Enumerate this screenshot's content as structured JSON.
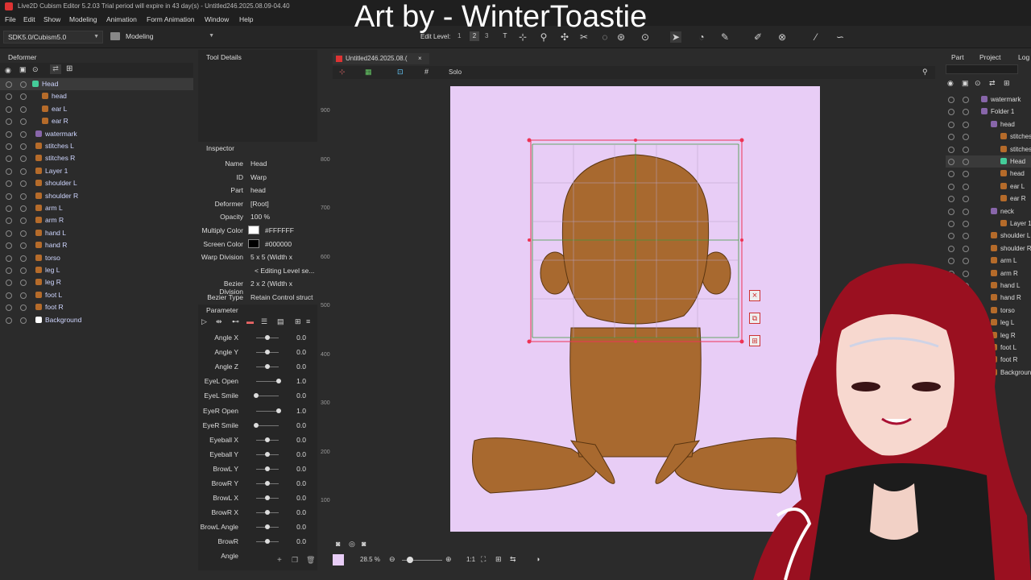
{
  "titlebar": {
    "text": "Live2D Cubism Editor 5.2.03   Trial period will expire in 43 day(s)  - Untitled246.2025.08.09-04.40"
  },
  "overlay": {
    "title": "Art by - WinterToastie"
  },
  "menu": [
    "File",
    "Edit",
    "Show",
    "Modeling",
    "Animation",
    "Form Animation",
    "Window",
    "Help"
  ],
  "toolbar": {
    "sdk": "SDK5.0/Cubism5.0",
    "mode": "Modeling",
    "edit_level_label": "Edit Level:",
    "edit_levels": [
      "1",
      "2",
      "3"
    ]
  },
  "deformer_panel": {
    "title": "Deformer",
    "items": [
      {
        "label": "Head",
        "kind": "warp"
      },
      {
        "label": "head",
        "kind": "art"
      },
      {
        "label": "ear L",
        "kind": "art"
      },
      {
        "label": "ear R",
        "kind": "art"
      },
      {
        "label": "watermark",
        "kind": "folder"
      },
      {
        "label": "stitches L",
        "kind": "art"
      },
      {
        "label": "stitches R",
        "kind": "art"
      },
      {
        "label": "Layer 1",
        "kind": "art"
      },
      {
        "label": "shoulder L",
        "kind": "art"
      },
      {
        "label": "shoulder R",
        "kind": "art"
      },
      {
        "label": "arm L",
        "kind": "art"
      },
      {
        "label": "arm R",
        "kind": "art"
      },
      {
        "label": "hand L",
        "kind": "art"
      },
      {
        "label": "hand R",
        "kind": "art"
      },
      {
        "label": "torso",
        "kind": "art"
      },
      {
        "label": "leg L",
        "kind": "art"
      },
      {
        "label": "leg R",
        "kind": "art"
      },
      {
        "label": "foot L",
        "kind": "art"
      },
      {
        "label": "foot R",
        "kind": "art"
      },
      {
        "label": "Background",
        "kind": "bg"
      }
    ]
  },
  "tool_details": {
    "title": "Tool Details"
  },
  "inspector": {
    "title": "Inspector",
    "rows": [
      {
        "label": "Name",
        "value": "Head"
      },
      {
        "label": "ID",
        "value": "Warp"
      },
      {
        "label": "Part",
        "value": "head"
      },
      {
        "label": "Deformer",
        "value": "[Root]"
      },
      {
        "label": "Opacity",
        "value": "100 %"
      },
      {
        "label": "Multiply Color",
        "value": "#FFFFFF"
      },
      {
        "label": "Screen Color",
        "value": "#000000"
      },
      {
        "label": "Warp Division",
        "value": "5  x     5 (Width x"
      },
      {
        "label": "",
        "value": "< Editing Level se..."
      },
      {
        "label": "Bezier Division",
        "value": "2  x     2 (Width x"
      },
      {
        "label": "Bezier Type",
        "value": "Retain Control struct"
      }
    ]
  },
  "parameter_panel": {
    "title": "Parameter",
    "params": [
      {
        "name": "Angle X",
        "value": "0.0",
        "level": 0.5
      },
      {
        "name": "Angle Y",
        "value": "0.0",
        "level": 0.5
      },
      {
        "name": "Angle Z",
        "value": "0.0",
        "level": 0.5
      },
      {
        "name": "EyeL Open",
        "value": "1.0",
        "level": 1.0
      },
      {
        "name": "EyeL Smile",
        "value": "0.0",
        "level": 0.0
      },
      {
        "name": "EyeR Open",
        "value": "1.0",
        "level": 1.0
      },
      {
        "name": "EyeR Smile",
        "value": "0.0",
        "level": 0.0
      },
      {
        "name": "Eyeball X",
        "value": "0.0",
        "level": 0.5
      },
      {
        "name": "Eyeball Y",
        "value": "0.0",
        "level": 0.5
      },
      {
        "name": "BrowL Y",
        "value": "0.0",
        "level": 0.5
      },
      {
        "name": "BrowR Y",
        "value": "0.0",
        "level": 0.5
      },
      {
        "name": "BrowL X",
        "value": "0.0",
        "level": 0.5
      },
      {
        "name": "BrowR X",
        "value": "0.0",
        "level": 0.5
      },
      {
        "name": "BrowL Angle",
        "value": "0.0",
        "level": 0.5
      },
      {
        "name": "BrowR Angle",
        "value": "0.0",
        "level": 0.5
      }
    ]
  },
  "canvas": {
    "tab": "Untitled246.2025.08.(",
    "solo": "Solo",
    "zoom": "28.5 %",
    "ruler": [
      "900",
      "800",
      "700",
      "600",
      "500",
      "400",
      "300",
      "200",
      "100"
    ],
    "ratio": "1:1"
  },
  "right_panel": {
    "tabs": [
      "Part",
      "Project",
      "Log"
    ],
    "items": [
      {
        "label": "watermark",
        "indent": 0
      },
      {
        "label": "Folder 1",
        "indent": 0
      },
      {
        "label": "head",
        "indent": 1
      },
      {
        "label": "stitches",
        "indent": 2
      },
      {
        "label": "stitches",
        "indent": 2
      },
      {
        "label": "Head",
        "indent": 2
      },
      {
        "label": "head",
        "indent": 2
      },
      {
        "label": "ear L",
        "indent": 2
      },
      {
        "label": "ear R",
        "indent": 2
      },
      {
        "label": "neck",
        "indent": 1
      },
      {
        "label": "Layer 1",
        "indent": 2
      },
      {
        "label": "shoulder L",
        "indent": 1
      },
      {
        "label": "shoulder R",
        "indent": 1
      },
      {
        "label": "arm L",
        "indent": 1
      },
      {
        "label": "arm R",
        "indent": 1
      },
      {
        "label": "hand L",
        "indent": 1
      },
      {
        "label": "hand R",
        "indent": 1
      },
      {
        "label": "torso",
        "indent": 1
      },
      {
        "label": "leg L",
        "indent": 1
      },
      {
        "label": "leg R",
        "indent": 1
      },
      {
        "label": "foot L",
        "indent": 1
      },
      {
        "label": "foot R",
        "indent": 1
      },
      {
        "label": "Background",
        "indent": 1
      }
    ]
  },
  "colors": {
    "accent": "#d33",
    "warp": "#3c9a3c",
    "doc_bg": "#e8cdf6",
    "skin": "#a8692f"
  }
}
